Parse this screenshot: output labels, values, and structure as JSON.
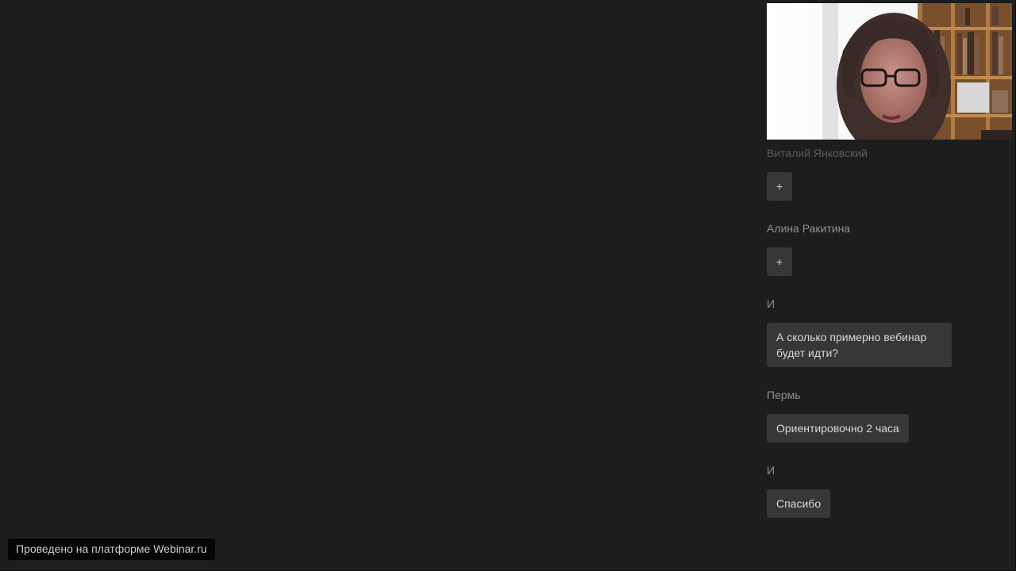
{
  "chat": {
    "messages": [
      {
        "sender": "Виталий Янковский",
        "text": "+"
      },
      {
        "sender": "Алина Ракитина",
        "text": "+"
      },
      {
        "sender": "И",
        "text": "А сколько примерно вебинар будет идти?"
      },
      {
        "sender": "Пермь",
        "text": "Ориентировочно 2 часа"
      },
      {
        "sender": "И",
        "text": "Спасибо"
      }
    ]
  },
  "footer": {
    "platform_badge": "Проведено на платформе Webinar.ru"
  },
  "colors": {
    "background": "#1c1d1d",
    "bubble": "#363738",
    "sender_text": "#8f9191",
    "bubble_text": "#d7d8d8"
  },
  "icons": {
    "video": "webcam-feed"
  }
}
